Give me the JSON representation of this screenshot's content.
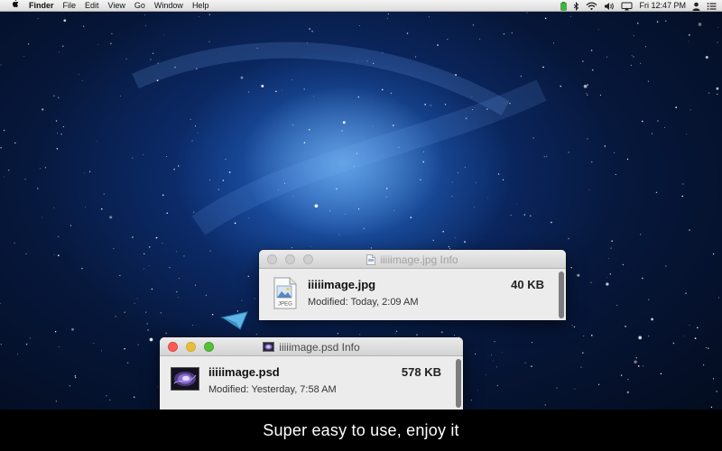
{
  "menubar": {
    "apple_icon": "apple-logo-icon",
    "app_name": "Finder",
    "items": [
      "File",
      "Edit",
      "View",
      "Go",
      "Window",
      "Help"
    ],
    "status_icons": [
      "battery-charging-icon",
      "bluetooth-icon",
      "wifi-icon",
      "volume-icon",
      "airplay-icon"
    ],
    "clock": "Fri 12:47 PM",
    "user_icon": "user-icon",
    "list_icon": "notification-center-icon"
  },
  "windows": {
    "jpg_info": {
      "title": "iiiiimage.jpg Info",
      "file_name": "iiiiimage.jpg",
      "file_size": "40 KB",
      "modified": "Modified: Today, 2:09 AM",
      "icon_label": "JPEG",
      "state": "inactive"
    },
    "psd_info": {
      "title": "iiiiimage.psd Info",
      "file_name": "iiiiimage.psd",
      "file_size": "578 KB",
      "modified": "Modified: Yesterday, 7:58 AM",
      "state": "active"
    }
  },
  "caption": "Super easy to use, enjoy it",
  "colors": {
    "close": "#fc5b57",
    "minimize": "#e5bf3c",
    "maximize": "#57c038",
    "wallpaper_core": "#3a8be0",
    "arrow": "#62b8e6"
  }
}
